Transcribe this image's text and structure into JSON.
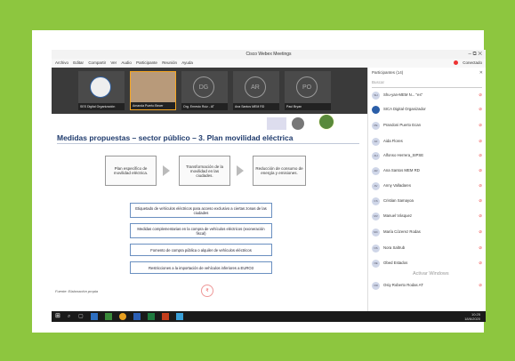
{
  "window": {
    "title": "Cisco Webex Meetings",
    "controls": "– ⧉ ✕",
    "connected_label": "Conectado"
  },
  "menu": [
    "Archivo",
    "Editar",
    "Compartir",
    "Ver",
    "Audio",
    "Participante",
    "Reunión",
    "Ayuda"
  ],
  "video_tiles": [
    {
      "initials": "",
      "label": "SES Digital Organización"
    },
    {
      "initials": "",
      "label": "Amanda Puerto Becer"
    },
    {
      "initials": "DG",
      "label": "Org. Ernesto Ruiz - AT"
    },
    {
      "initials": "AR",
      "label": "Ana Santos MEM RD"
    },
    {
      "initials": "PO",
      "label": "Paul Bryan"
    }
  ],
  "slide": {
    "title": "Medidas propuestas – sector público – 3. Plan movilidad eléctrica",
    "flow": [
      "Plan específico de movilidad eléctrica.",
      "Transformación de la movilidad en las ciudades.",
      "Reducción de consumo de energía y emisiones."
    ],
    "measures": [
      "Etiquetado de vehículos eléctricos para acceso exclusivo a ciertas zonas de las ciudades",
      "Medidas complementarias en la compra de vehículos eléctricos (exoneración fiscal)",
      "Fomento de compra pública o alquiler de vehículos eléctricos",
      "Restricciones a la importación de vehículos inferiores a EURO3"
    ],
    "source": "Fuente: Elaboración propia"
  },
  "participants_panel": {
    "header": "Participantes (14)",
    "search_placeholder": "Buscar",
    "people": [
      {
        "initials": "SH",
        "name": "Shu-yan-MEM N... \"es\""
      },
      {
        "initials": "",
        "name": "SICA Digital Organizador"
      },
      {
        "initials": "PE",
        "name": "Prandoni Puerto Ecan"
      },
      {
        "initials": "AF",
        "name": "Aida Flores"
      },
      {
        "initials": "AH",
        "name": "Alfonso Herrera_SIPSE"
      },
      {
        "initials": "AR",
        "name": "Ana Santos MEM RD"
      },
      {
        "initials": "AV",
        "name": "Anny Valladares"
      },
      {
        "initials": "CS",
        "name": "Cristian Samayoa"
      },
      {
        "initials": "MV",
        "name": "Manuel Vásquez"
      },
      {
        "initials": "MC",
        "name": "María Cózerez Rodas"
      },
      {
        "initials": "NS",
        "name": "Nora Saltrub"
      },
      {
        "initials": "OE",
        "name": "Obed Estados"
      },
      {
        "initials": "OR",
        "name": "Osiy Roberto Rodas AT"
      }
    ],
    "watermark": "Activar Windows"
  },
  "taskbar": {
    "time": "10:25",
    "date": "18/6/2020"
  }
}
